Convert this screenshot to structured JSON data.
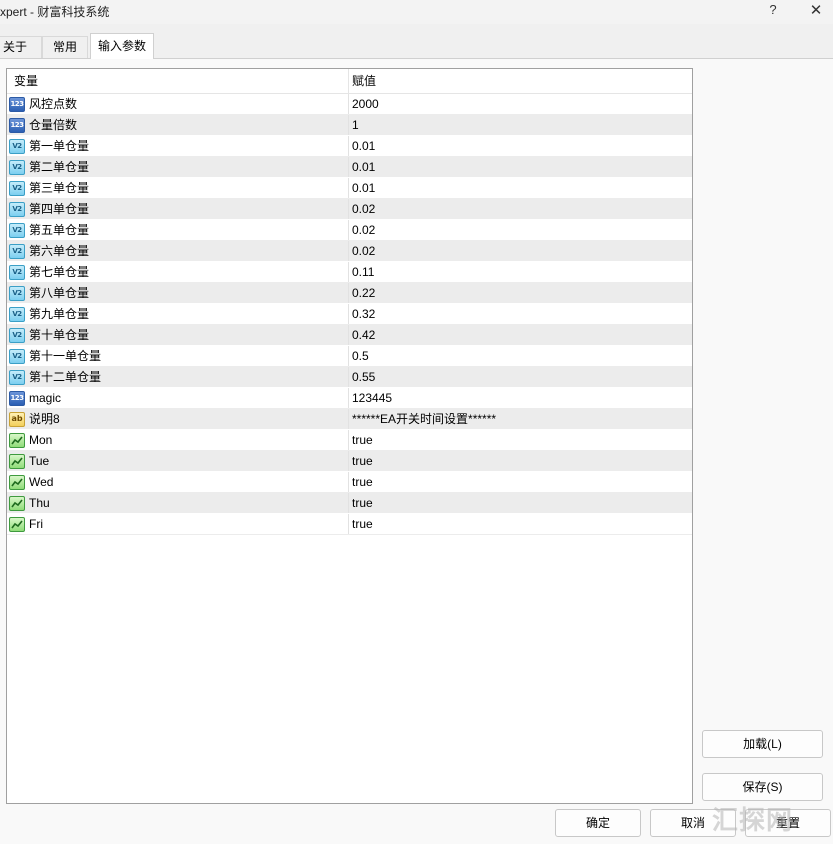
{
  "window": {
    "title": "xpert - 财富科技系统",
    "help_label": "?",
    "close_label": "✕"
  },
  "tabs": [
    {
      "label": "关于"
    },
    {
      "label": "常用"
    },
    {
      "label": "输入参数",
      "active": true
    }
  ],
  "grid": {
    "columns": [
      "变量",
      "赋值"
    ],
    "rows": [
      {
        "type": "int",
        "icon": "integer-type-icon",
        "icon_text": "123",
        "name": "风控点数",
        "value": "2000"
      },
      {
        "type": "int",
        "icon": "integer-type-icon",
        "icon_text": "123",
        "name": "仓量倍数",
        "value": "1"
      },
      {
        "type": "double",
        "icon": "double-type-icon",
        "icon_text": "V2",
        "name": "第一单仓量",
        "value": "0.01"
      },
      {
        "type": "double",
        "icon": "double-type-icon",
        "icon_text": "V2",
        "name": "第二单仓量",
        "value": "0.01"
      },
      {
        "type": "double",
        "icon": "double-type-icon",
        "icon_text": "V2",
        "name": "第三单仓量",
        "value": "0.01"
      },
      {
        "type": "double",
        "icon": "double-type-icon",
        "icon_text": "V2",
        "name": "第四单仓量",
        "value": "0.02"
      },
      {
        "type": "double",
        "icon": "double-type-icon",
        "icon_text": "V2",
        "name": "第五单仓量",
        "value": "0.02"
      },
      {
        "type": "double",
        "icon": "double-type-icon",
        "icon_text": "V2",
        "name": "第六单仓量",
        "value": "0.02"
      },
      {
        "type": "double",
        "icon": "double-type-icon",
        "icon_text": "V2",
        "name": "第七单仓量",
        "value": "0.11"
      },
      {
        "type": "double",
        "icon": "double-type-icon",
        "icon_text": "V2",
        "name": "第八单仓量",
        "value": "0.22"
      },
      {
        "type": "double",
        "icon": "double-type-icon",
        "icon_text": "V2",
        "name": "第九单仓量",
        "value": "0.32"
      },
      {
        "type": "double",
        "icon": "double-type-icon",
        "icon_text": "V2",
        "name": "第十单仓量",
        "value": "0.42"
      },
      {
        "type": "double",
        "icon": "double-type-icon",
        "icon_text": "V2",
        "name": "第十一单仓量",
        "value": "0.5"
      },
      {
        "type": "double",
        "icon": "double-type-icon",
        "icon_text": "V2",
        "name": "第十二单仓量",
        "value": "0.55"
      },
      {
        "type": "int",
        "icon": "integer-type-icon",
        "icon_text": "123",
        "name": "magic",
        "value": "123445"
      },
      {
        "type": "string",
        "icon": "string-type-icon",
        "icon_text": "ab",
        "name": "说明8",
        "value": "******EA开关时间设置******"
      },
      {
        "type": "bool",
        "icon": "boolean-type-icon",
        "icon_text": "",
        "name": "Mon",
        "value": "true"
      },
      {
        "type": "bool",
        "icon": "boolean-type-icon",
        "icon_text": "",
        "name": "Tue",
        "value": "true"
      },
      {
        "type": "bool",
        "icon": "boolean-type-icon",
        "icon_text": "",
        "name": "Wed",
        "value": "true"
      },
      {
        "type": "bool",
        "icon": "boolean-type-icon",
        "icon_text": "",
        "name": "Thu",
        "value": "true"
      },
      {
        "type": "bool",
        "icon": "boolean-type-icon",
        "icon_text": "",
        "name": "Fri",
        "value": "true"
      }
    ]
  },
  "buttons": {
    "load": "加载(L)",
    "save": "保存(S)",
    "ok": "确定",
    "cancel": "取消",
    "reset": "重置"
  },
  "watermark": "汇探网"
}
